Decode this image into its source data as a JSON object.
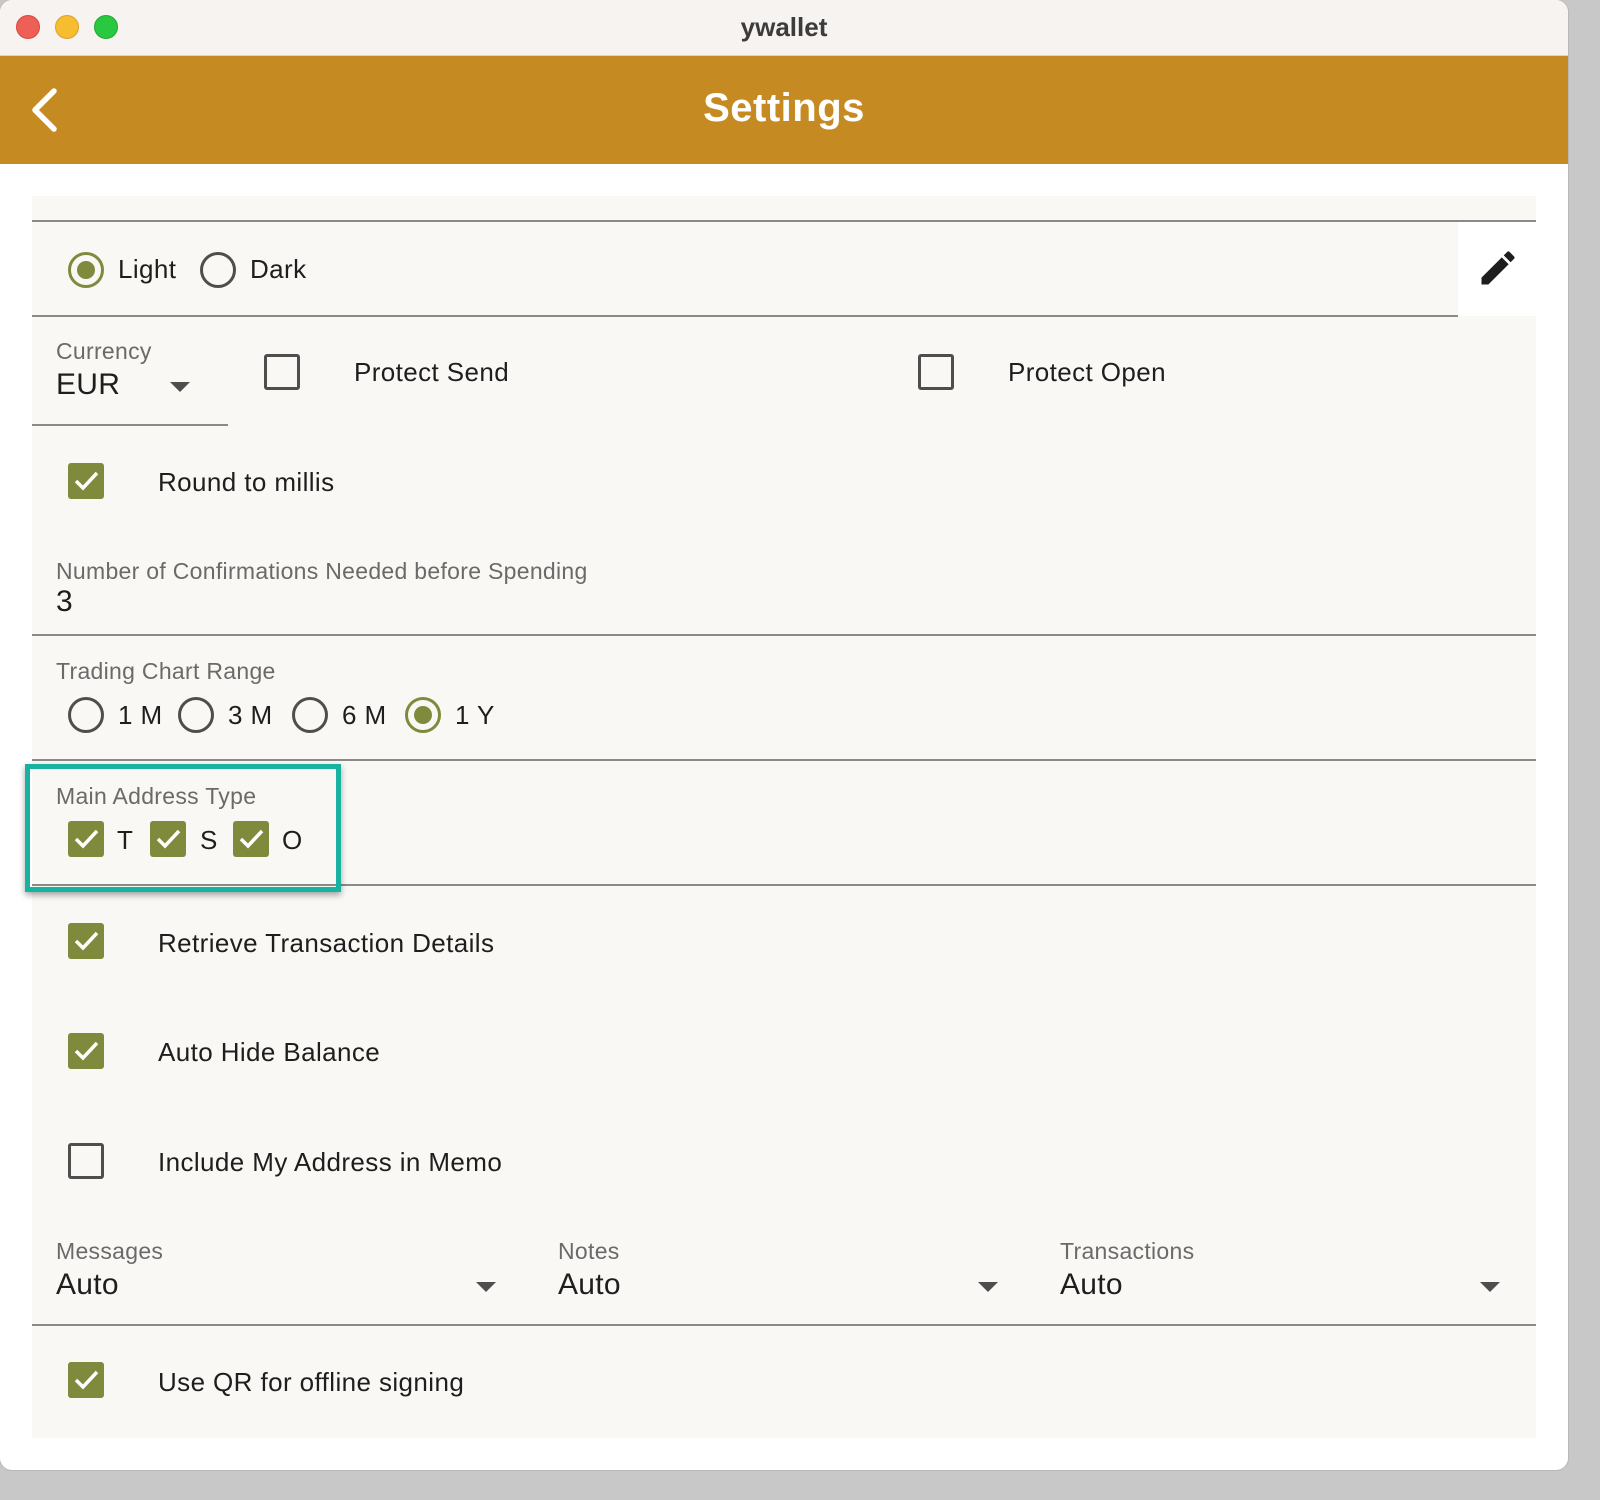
{
  "window": {
    "title": "ywallet"
  },
  "appbar": {
    "title": "Settings"
  },
  "theme": {
    "options": [
      {
        "label": "Light",
        "selected": true
      },
      {
        "label": "Dark",
        "selected": false
      }
    ]
  },
  "currency": {
    "label": "Currency",
    "value": "EUR"
  },
  "protect_send": {
    "label": "Protect Send",
    "checked": false
  },
  "protect_open": {
    "label": "Protect Open",
    "checked": false
  },
  "round_to_millis": {
    "label": "Round to millis",
    "checked": true
  },
  "confirmations": {
    "label": "Number of Confirmations Needed before Spending",
    "value": "3"
  },
  "chart_range": {
    "label": "Trading Chart Range",
    "options": [
      {
        "label": "1 M",
        "selected": false
      },
      {
        "label": "3 M",
        "selected": false
      },
      {
        "label": "6 M",
        "selected": false
      },
      {
        "label": "1 Y",
        "selected": true
      }
    ]
  },
  "main_address_type": {
    "label": "Main Address Type",
    "options": [
      {
        "label": "T",
        "checked": true
      },
      {
        "label": "S",
        "checked": true
      },
      {
        "label": "O",
        "checked": true
      }
    ]
  },
  "retrieve_tx_details": {
    "label": "Retrieve Transaction Details",
    "checked": true
  },
  "auto_hide_balance": {
    "label": "Auto Hide Balance",
    "checked": true
  },
  "include_address_memo": {
    "label": "Include My Address in Memo",
    "checked": false
  },
  "dropdowns": {
    "messages": {
      "label": "Messages",
      "value": "Auto"
    },
    "notes": {
      "label": "Notes",
      "value": "Auto"
    },
    "transactions": {
      "label": "Transactions",
      "value": "Auto"
    }
  },
  "qr_offline_signing": {
    "label": "Use QR for offline signing",
    "checked": true
  },
  "colors": {
    "appbar": "#c58b22",
    "accent": "#808a3c",
    "highlight": "#17b3a0"
  }
}
